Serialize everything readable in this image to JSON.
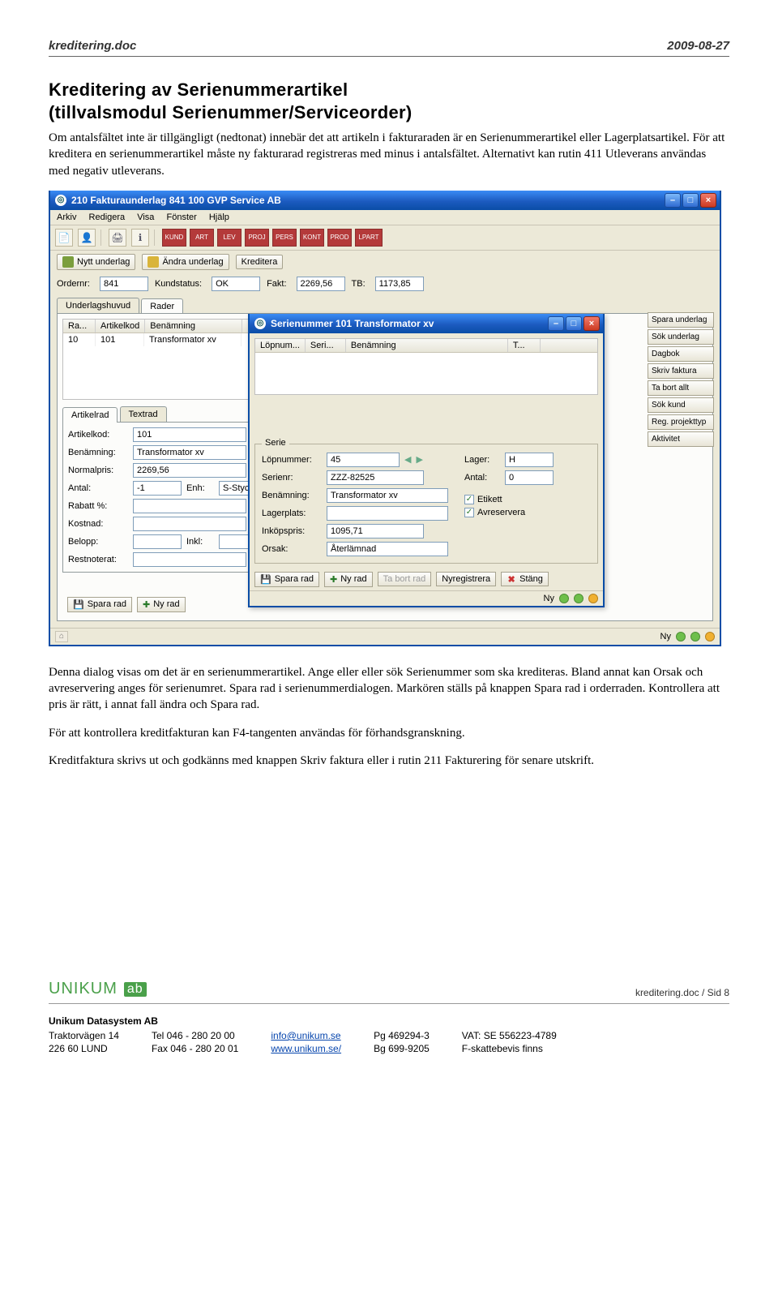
{
  "header": {
    "left": "kreditering.doc",
    "right": "2009-08-27"
  },
  "doc": {
    "title": "Kreditering av Serienummerartikel",
    "subtitle": "(tillvalsmodul Serienummer/Serviceorder)",
    "para1": "Om antalsfältet inte är tillgängligt (nedtonat) innebär det att artikeln i fakturaraden är en Serienummerartikel eller Lagerplatsartikel. För att kreditera en serienummerartikel måste ny fakturarad registreras med minus i antalsfältet. Alternativt kan rutin 411 Utleverans användas med negativ utleverans.",
    "para2": "Denna dialog visas om det är en serienummerartikel. Ange eller eller sök Serienummer som ska krediteras. Bland annat kan Orsak och avreservering anges för serienumret. Spara rad i serienummerdialogen. Markören ställs på knappen Spara rad i orderraden. Kontrollera att pris är rätt, i annat fall ändra och Spara rad.",
    "para3": "För att kontrollera kreditfakturan kan F4-tangenten användas för förhandsgranskning.",
    "para4": "Kreditfaktura skrivs ut och godkänns med knappen Skriv faktura eller i rutin 211 Fakturering för senare utskrift."
  },
  "mainwin": {
    "title": "210 Fakturaunderlag 841  100  GVP Service AB",
    "menus": [
      "Arkiv",
      "Redigera",
      "Visa",
      "Fönster",
      "Hjälp"
    ],
    "pillbadges": [
      "KUND",
      "ART",
      "LEV",
      "PROJ",
      "PERS",
      "KONT",
      "PROD",
      "LPART"
    ],
    "actions": {
      "ny": "Nytt underlag",
      "andra": "Ändra underlag",
      "kred": "Kreditera"
    },
    "orderbar": {
      "ordernr_l": "Ordernr:",
      "ordernr": "841",
      "kundstatus_l": "Kundstatus:",
      "kundstatus": "OK",
      "fakt_l": "Fakt:",
      "fakt": "2269,56",
      "tb_l": "TB:",
      "tb": "1173,85"
    },
    "tabs": {
      "a": "Underlagshuvud",
      "b": "Rader"
    },
    "grid": {
      "h1": "Ra...",
      "h2": "Artikelkod",
      "h3": "Benämning",
      "r1c1": "10",
      "r1c2": "101",
      "r1c3": "Transformator xv"
    },
    "rightbtns": [
      "Spara underlag",
      "Sök underlag",
      "Dagbok",
      "Skriv faktura",
      "Ta bort allt",
      "Sök kund",
      "Reg. projekttyp",
      "Aktivitet"
    ],
    "formtabs": {
      "a": "Artikelrad",
      "b": "Textrad"
    },
    "form": {
      "artikelkod_l": "Artikelkod:",
      "artikelkod": "101",
      "benamning_l": "Benämning:",
      "benamning": "Transformator xv",
      "normalpris_l": "Normalpris:",
      "normalpris": "2269,56",
      "antal_l": "Antal:",
      "antal": "-1",
      "enh_l": "Enh:",
      "enh": "S-Styck",
      "rabatt_l": "Rabatt %:",
      "rabatt": "",
      "kostnad_l": "Kostnad:",
      "kostnad": "",
      "belopp_l": "Belopp:",
      "belopp": "",
      "inkl_l": "Inkl:",
      "inkl": "",
      "restnot_l": "Restnoterat:",
      "restnot": ""
    },
    "bottom": {
      "spara": "Spara rad",
      "ny": "Ny rad"
    },
    "status": {
      "ny1": "Ny",
      "ny2": "Ny"
    }
  },
  "popup": {
    "title": "Serienummer  101  Transformator xv",
    "grid": {
      "h1": "Löpnum...",
      "h2": "Seri...",
      "h3": "Benämning",
      "h4": "T..."
    },
    "serie": {
      "legend": "Serie",
      "lopn_l": "Löpnummer:",
      "lopn": "45",
      "serienr_l": "Serienr:",
      "serienr": "ZZZ-82525",
      "benamning_l": "Benämning:",
      "benamning": "Transformator xv",
      "lager_l": "Lager:",
      "lager": "H",
      "antal_l": "Antal:",
      "antal": "0",
      "lagerplats_l": "Lagerplats:",
      "lagerplats": "",
      "inkopspris_l": "Inköpspris:",
      "inkopspris": "1095,71",
      "orsak_l": "Orsak:",
      "orsak": "Återlämnad",
      "etikett": "Etikett",
      "avres": "Avreservera"
    },
    "btns": {
      "spara": "Spara rad",
      "ny": "Ny rad",
      "tabort": "Ta bort rad",
      "nyreg": "Nyregistrera",
      "stang": "Stäng"
    },
    "status_ny": "Ny"
  },
  "footer": {
    "sid": "kreditering.doc / Sid 8",
    "logo1": "UNIKUM",
    "logo2": "ab",
    "company": "Unikum Datasystem AB",
    "addr1": "Traktorvägen 14",
    "addr2": "226 60  LUND",
    "tel": "Tel   046 - 280 20 00",
    "fax": "Fax  046 - 280 20 01",
    "email": "info@unikum.se",
    "web": "www.unikum.se/",
    "pg": "Pg  469294-3",
    "bg": "Bg  699-9205",
    "vat": "VAT: SE 556223-4789",
    "fskatt": "F-skattebevis finns"
  }
}
